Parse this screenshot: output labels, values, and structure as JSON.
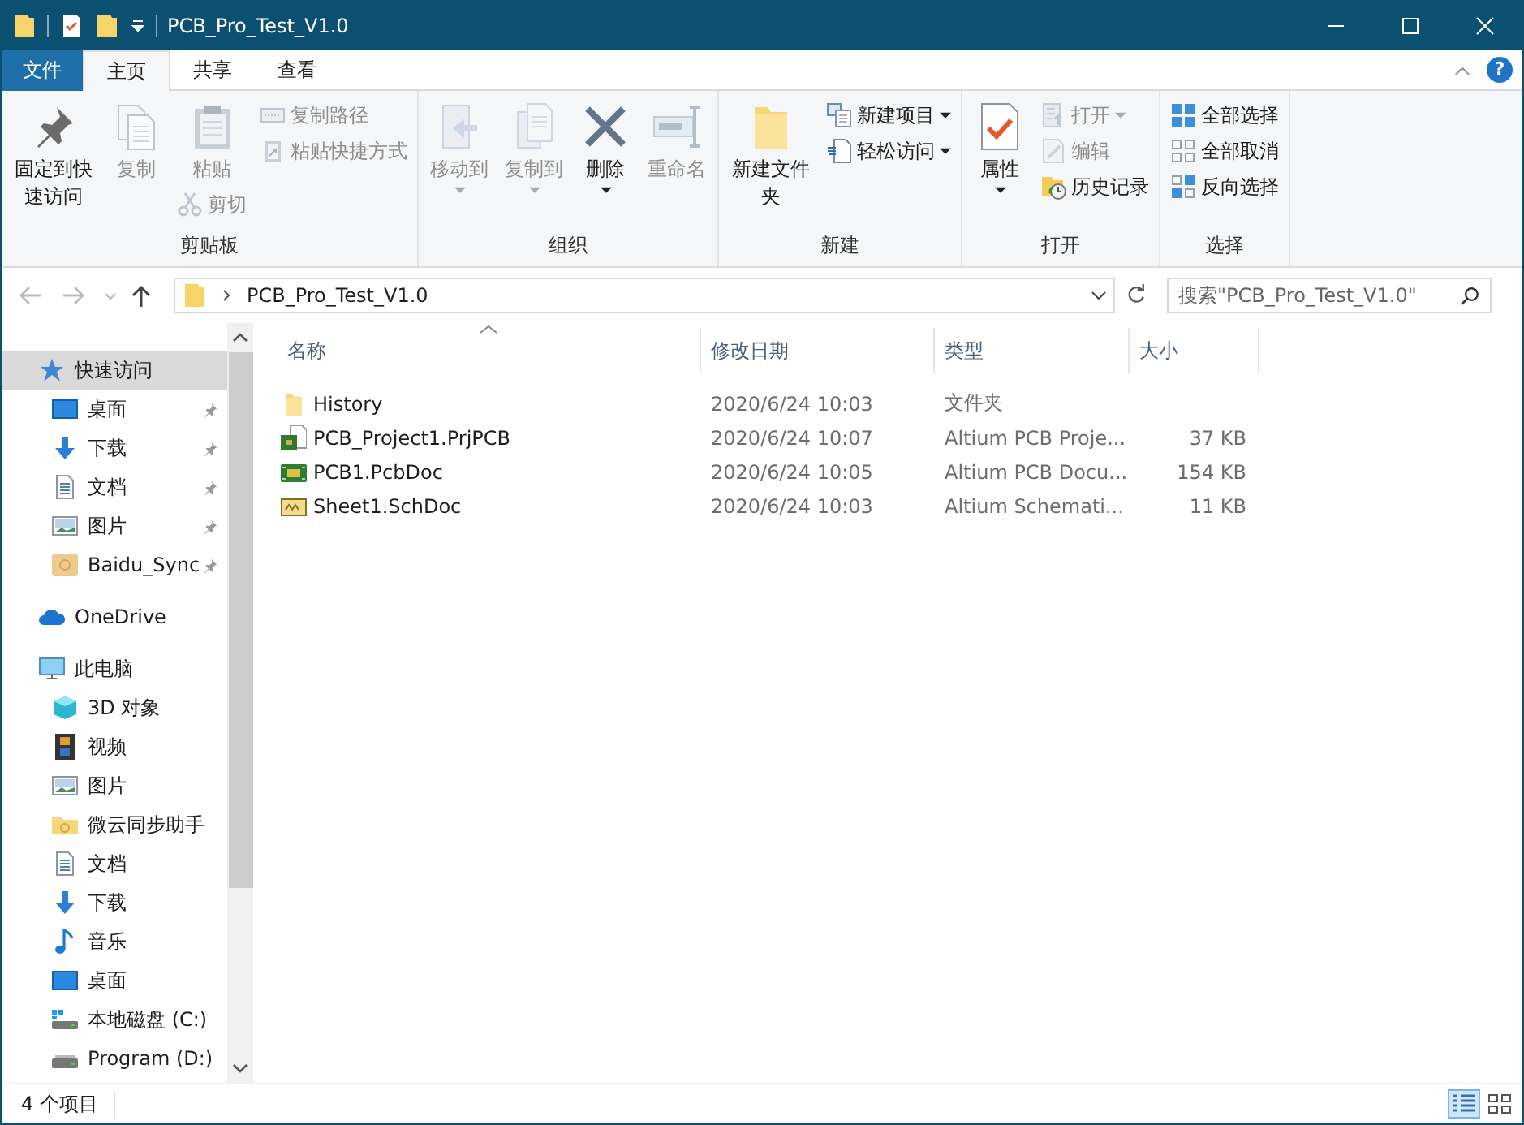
{
  "window": {
    "title": "PCB_Pro_Test_V1.0"
  },
  "ribbon_tabs": [
    {
      "label": "文件",
      "kind": "file",
      "selected": false
    },
    {
      "label": "主页",
      "kind": "tab",
      "selected": true
    },
    {
      "label": "共享",
      "kind": "tab",
      "selected": false
    },
    {
      "label": "查看",
      "kind": "tab",
      "selected": false
    }
  ],
  "help_label": "?",
  "ribbon_groups": [
    {
      "label": "剪贴板",
      "columns": [
        {
          "commands": [
            {
              "label": "固定到快速访问",
              "kind": "large",
              "disabled": false,
              "dropdown": false
            }
          ]
        },
        {
          "commands": [
            {
              "label": "复制",
              "kind": "large",
              "disabled": true,
              "dropdown": false
            }
          ]
        },
        {
          "commands": [
            {
              "label": "粘贴",
              "kind": "large",
              "disabled": true,
              "dropdown": false
            },
            {
              "label": "剪切",
              "kind": "small",
              "disabled": true,
              "dropdown": false
            }
          ]
        },
        {
          "commands": [
            {
              "label": "复制路径",
              "kind": "small",
              "disabled": true,
              "dropdown": false
            },
            {
              "label": "粘贴快捷方式",
              "kind": "small",
              "disabled": true,
              "dropdown": false
            }
          ]
        }
      ]
    },
    {
      "label": "组织",
      "columns": [
        {
          "commands": [
            {
              "label": "移动到",
              "kind": "large",
              "disabled": true,
              "dropdown": true
            }
          ]
        },
        {
          "commands": [
            {
              "label": "复制到",
              "kind": "large",
              "disabled": true,
              "dropdown": true
            }
          ]
        },
        {
          "commands": [
            {
              "label": "删除",
              "kind": "large",
              "disabled": false,
              "dropdown": true
            }
          ]
        },
        {
          "commands": [
            {
              "label": "重命名",
              "kind": "large",
              "disabled": true,
              "dropdown": false
            }
          ]
        }
      ]
    },
    {
      "label": "新建",
      "columns": [
        {
          "commands": [
            {
              "label": "新建文件夹",
              "kind": "large",
              "disabled": false,
              "dropdown": false
            }
          ]
        },
        {
          "commands": [
            {
              "label": "新建项目",
              "kind": "small",
              "disabled": false,
              "dropdown": true
            },
            {
              "label": "轻松访问",
              "kind": "small",
              "disabled": false,
              "dropdown": true
            }
          ]
        }
      ]
    },
    {
      "label": "打开",
      "columns": [
        {
          "commands": [
            {
              "label": "属性",
              "kind": "large",
              "disabled": false,
              "dropdown": true
            }
          ]
        },
        {
          "commands": [
            {
              "label": "打开",
              "kind": "small",
              "disabled": true,
              "dropdown": true
            },
            {
              "label": "编辑",
              "kind": "small",
              "disabled": true,
              "dropdown": false
            },
            {
              "label": "历史记录",
              "kind": "small",
              "disabled": false,
              "dropdown": false
            }
          ]
        }
      ]
    },
    {
      "label": "选择",
      "columns": [
        {
          "commands": [
            {
              "label": "全部选择",
              "kind": "small",
              "disabled": false,
              "dropdown": false
            },
            {
              "label": "全部取消",
              "kind": "small",
              "disabled": false,
              "dropdown": false
            },
            {
              "label": "反向选择",
              "kind": "small",
              "disabled": false,
              "dropdown": false
            }
          ]
        }
      ]
    }
  ],
  "address": {
    "path": "PCB_Pro_Test_V1.0"
  },
  "search": {
    "placeholder": "搜索\"PCB_Pro_Test_V1.0\""
  },
  "sidebar": {
    "items": [
      {
        "label": "快速访问",
        "selected": true,
        "children": [
          {
            "label": "桌面",
            "pinned": true
          },
          {
            "label": "下载",
            "pinned": true
          },
          {
            "label": "文档",
            "pinned": true
          },
          {
            "label": "图片",
            "pinned": true
          },
          {
            "label": "Baidu_Sync",
            "pinned": true
          }
        ]
      },
      {
        "label": "OneDrive",
        "selected": false
      },
      {
        "label": "此电脑",
        "selected": false,
        "children": [
          {
            "label": "3D 对象",
            "pinned": false
          },
          {
            "label": "视频",
            "pinned": false
          },
          {
            "label": "图片",
            "pinned": false
          },
          {
            "label": "微云同步助手",
            "pinned": false
          },
          {
            "label": "文档",
            "pinned": false
          },
          {
            "label": "下载",
            "pinned": false
          },
          {
            "label": "音乐",
            "pinned": false
          },
          {
            "label": "桌面",
            "pinned": false
          },
          {
            "label": "本地磁盘 (C:)",
            "pinned": false
          },
          {
            "label": "Program (D:)",
            "pinned": false
          }
        ]
      }
    ]
  },
  "table": {
    "columns": [
      "名称",
      "修改日期",
      "类型",
      "大小"
    ],
    "rows": [
      {
        "name": "History",
        "modified": "2020/6/24 10:03",
        "type": "文件夹",
        "size": ""
      },
      {
        "name": "PCB_Project1.PrjPCB",
        "modified": "2020/6/24 10:07",
        "type": "Altium PCB Proje...",
        "size": "37 KB"
      },
      {
        "name": "PCB1.PcbDoc",
        "modified": "2020/6/24 10:05",
        "type": "Altium PCB Docu...",
        "size": "154 KB"
      },
      {
        "name": "Sheet1.SchDoc",
        "modified": "2020/6/24 10:03",
        "type": "Altium Schemati...",
        "size": "11 KB"
      }
    ]
  },
  "status_bar": {
    "text": "4 个项目",
    "views": [
      {
        "kind": "details",
        "selected": true
      },
      {
        "kind": "tiles",
        "selected": false
      }
    ]
  }
}
